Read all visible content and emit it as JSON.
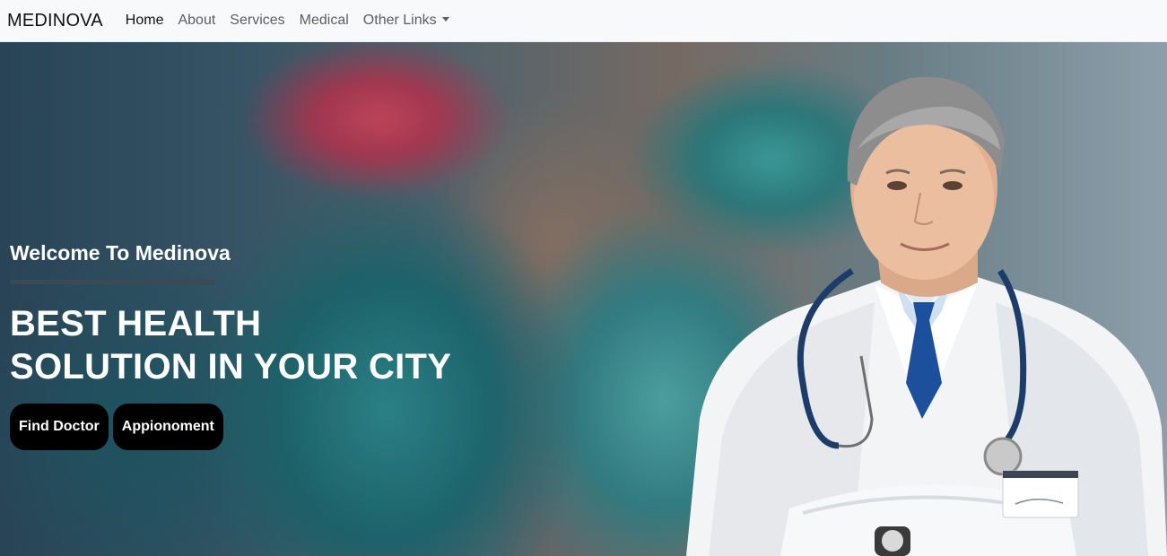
{
  "nav": {
    "brand": "MEDINOVA",
    "links": [
      "Home",
      "About",
      "Services",
      "Medical"
    ],
    "dropdown_label": "Other Links",
    "active": "Home"
  },
  "hero": {
    "welcome": "Welcome To Medinova",
    "headline_line1": "BEST HEALTH",
    "headline_line2": "SOLUTION IN YOUR CITY",
    "buttons": {
      "find_doctor": "Find Doctor",
      "appointment": "Appionoment"
    }
  },
  "colors": {
    "navbar_bg": "#f8f9fa",
    "button_bg": "#000000",
    "button_text": "#ffffff",
    "hero_text": "#ffffff"
  }
}
